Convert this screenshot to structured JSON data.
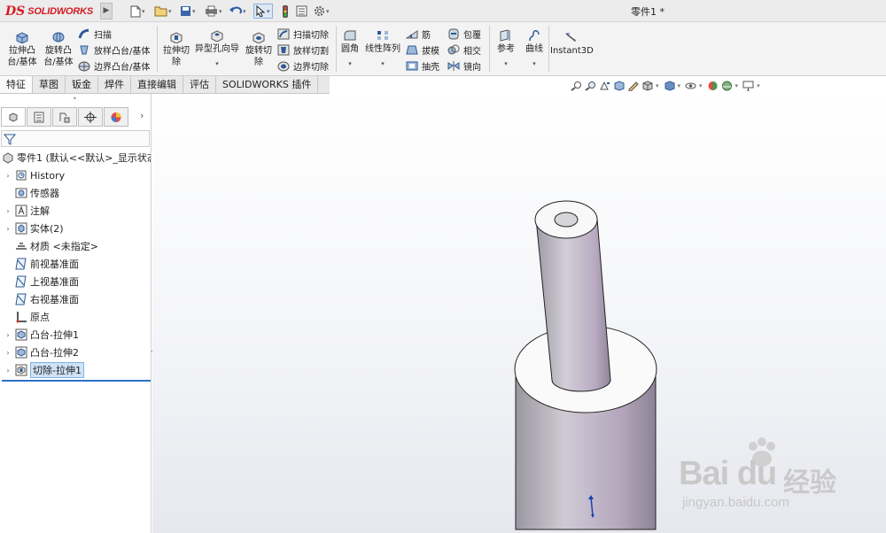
{
  "titlebar": {
    "logo_mark": "DS",
    "logo_text": "SOLIDWORKS",
    "document_title": "零件1 *"
  },
  "command_manager": {
    "extrude_boss": [
      "拉伸凸",
      "台/基体"
    ],
    "revolve_boss": [
      "旋转凸",
      "台/基体"
    ],
    "sweep": "扫描",
    "loft_boss": "放样凸台/基体",
    "boundary_boss": "边界凸台/基体",
    "extrude_cut": [
      "拉伸切",
      "除"
    ],
    "hole_wizard": "异型孔向导",
    "revolve_cut": [
      "旋转切",
      "除"
    ],
    "swept_cut": "扫描切除",
    "lofted_cut": "放样切割",
    "boundary_cut": "边界切除",
    "fillet": "圆角",
    "linear_pattern": "线性阵列",
    "rib": "筋",
    "draft": "拔模",
    "shell": "抽壳",
    "wrap": "包覆",
    "intersect": "相交",
    "mirror": "镜向",
    "reference": "参考",
    "curves": "曲线",
    "instant3d": "Instant3D"
  },
  "tabs": [
    "特征",
    "草图",
    "钣金",
    "焊件",
    "直接编辑",
    "评估",
    "SOLIDWORKS 插件"
  ],
  "tree": {
    "root": "零件1  (默认<<默认>_显示状态",
    "items": [
      {
        "label": "History",
        "icon": "history-icon",
        "expandable": true
      },
      {
        "label": "传感器",
        "icon": "sensor-icon",
        "expandable": false
      },
      {
        "label": "注解",
        "icon": "annotation-icon",
        "expandable": true
      },
      {
        "label": "实体(2)",
        "icon": "solid-bodies-icon",
        "expandable": true
      },
      {
        "label": "材质 <未指定>",
        "icon": "material-icon",
        "expandable": false
      },
      {
        "label": "前视基准面",
        "icon": "plane-icon",
        "expandable": false
      },
      {
        "label": "上视基准面",
        "icon": "plane-icon",
        "expandable": false
      },
      {
        "label": "右视基准面",
        "icon": "plane-icon",
        "expandable": false
      },
      {
        "label": "原点",
        "icon": "origin-icon",
        "expandable": false
      },
      {
        "label": "凸台-拉伸1",
        "icon": "extrude-feature-icon",
        "expandable": true
      },
      {
        "label": "凸台-拉伸2",
        "icon": "extrude-feature-icon",
        "expandable": true
      },
      {
        "label": "切除-拉伸1",
        "icon": "cut-feature-icon",
        "expandable": true,
        "selected": true
      }
    ]
  },
  "watermark": {
    "brand": "Bai du",
    "chinese": "经验",
    "url": "jingyan.baidu.com"
  },
  "colors": {
    "brand_red": "#d51a23",
    "selection_blue": "#2a72c6",
    "model_body": "#a8a3b2"
  }
}
